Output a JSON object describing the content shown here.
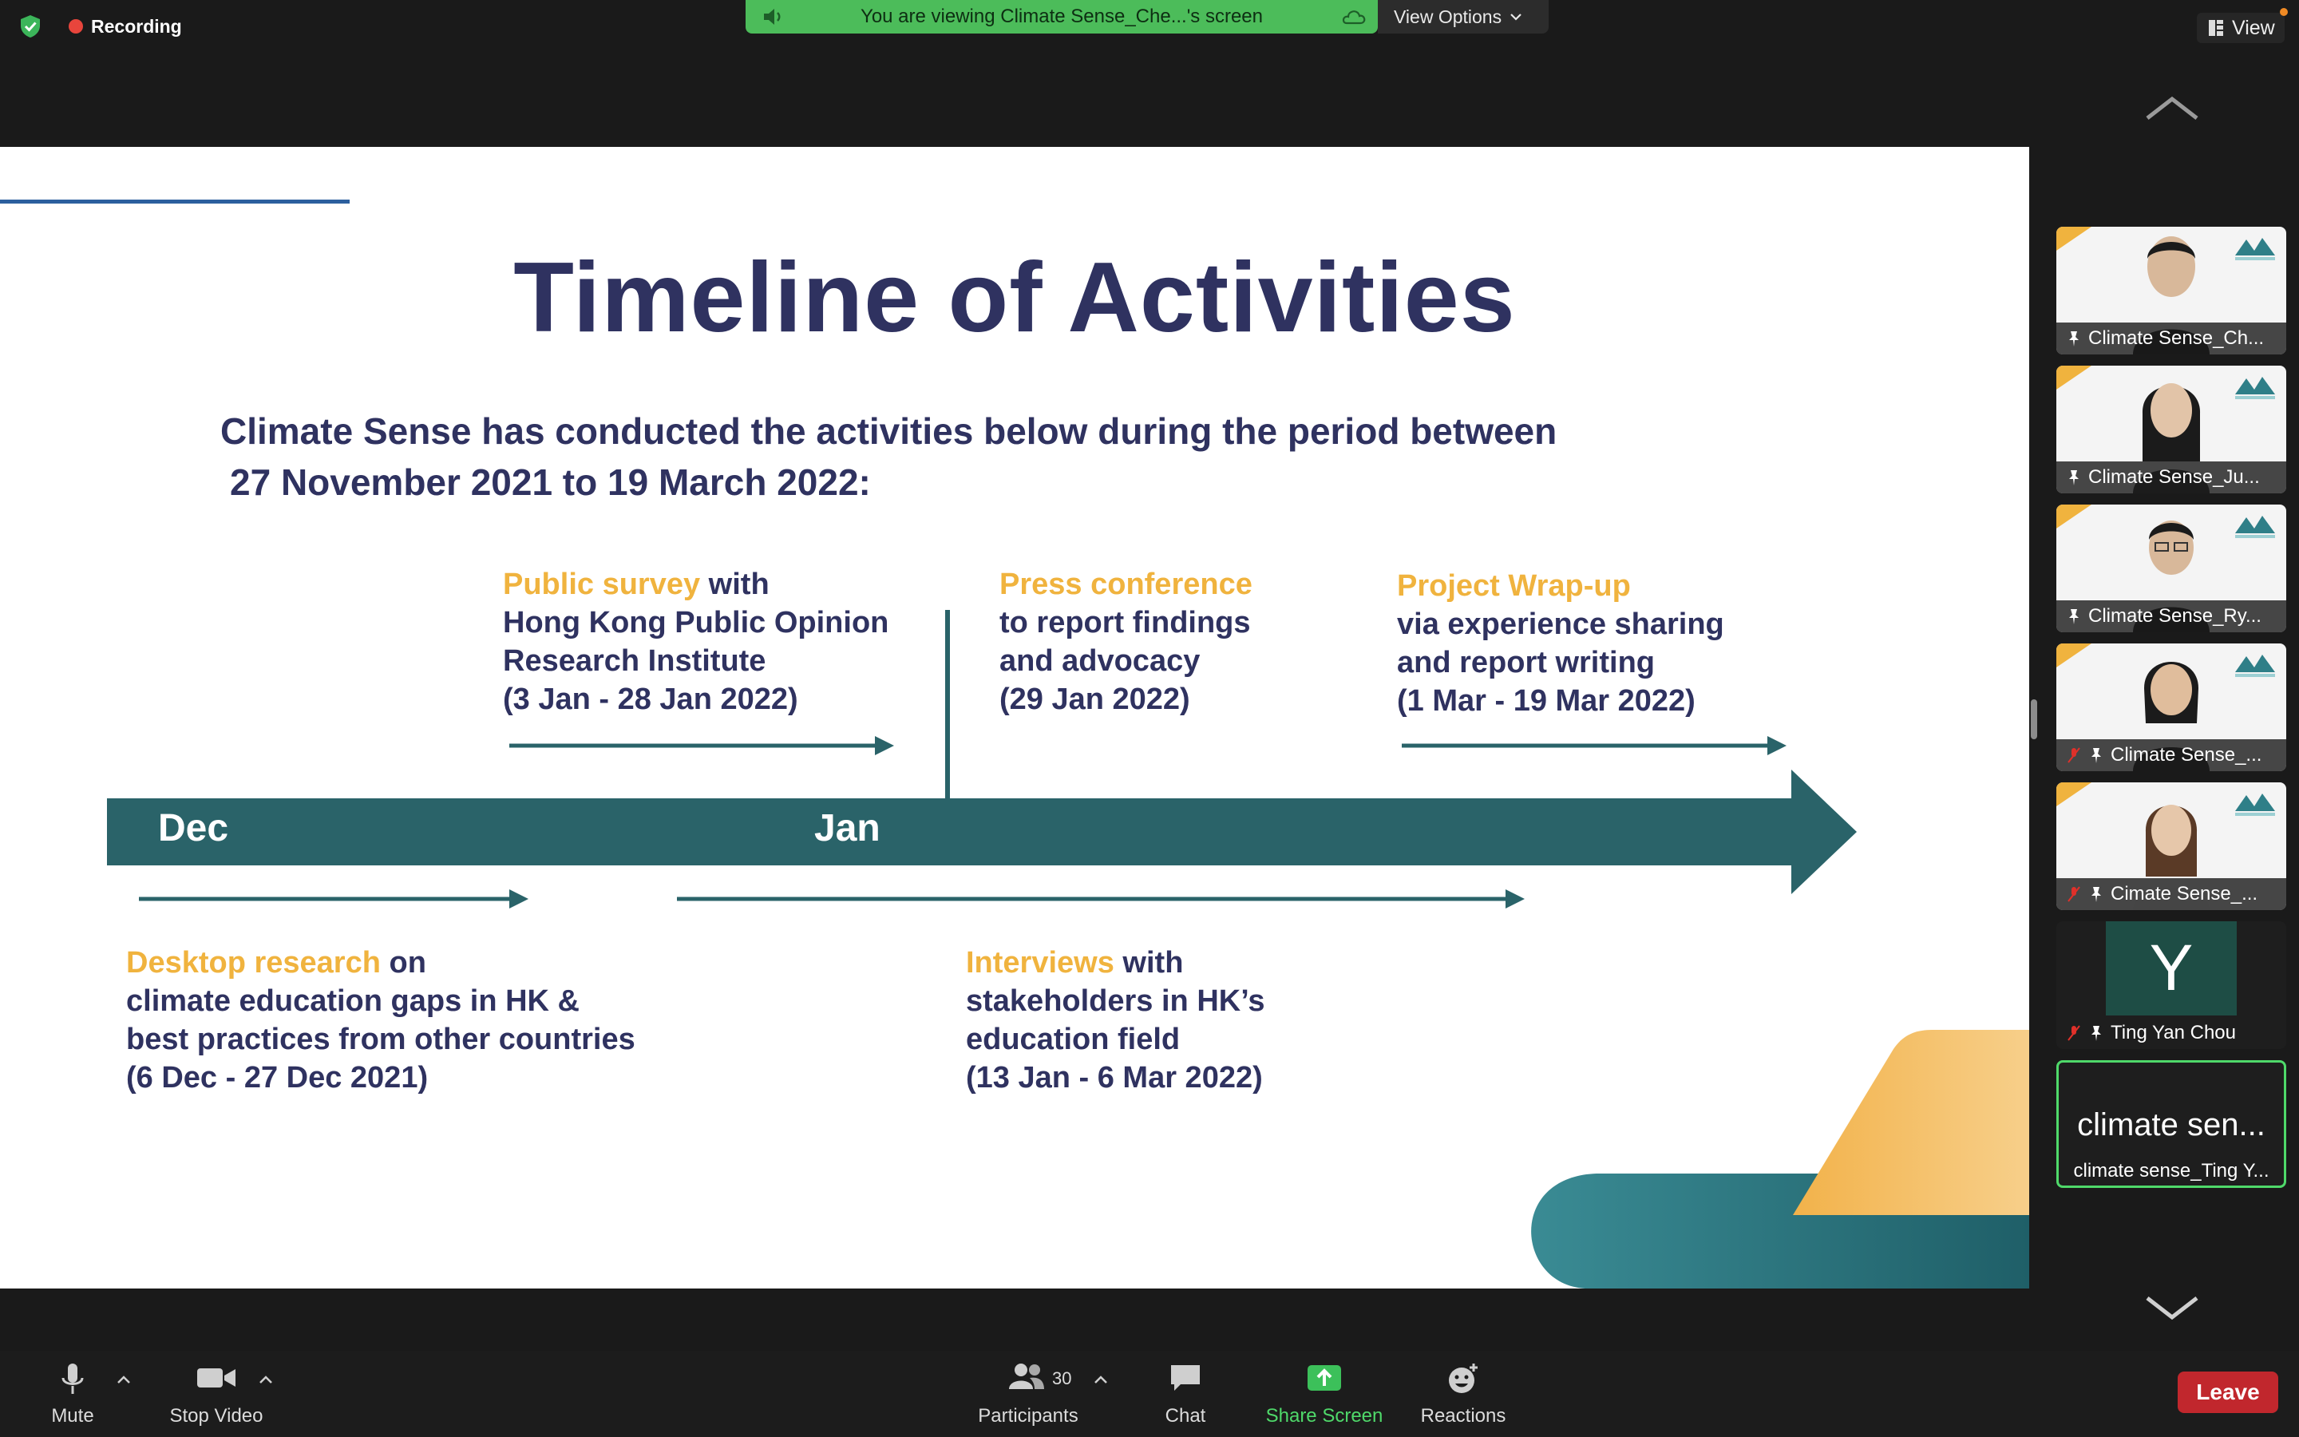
{
  "top_bar": {
    "recording_label": "Recording",
    "banner_text": "You are viewing Climate Sense_Che...'s screen",
    "view_options_label": "View Options",
    "view_label": "View"
  },
  "slide": {
    "title": "Timeline of Activities",
    "intro_line_1": "Climate Sense has conducted the activities below during the period between",
    "intro_line_2": "27 November 2021 to 19 March 2022:",
    "months": [
      "Dec",
      "Jan"
    ],
    "activities": {
      "public_survey": {
        "highlight": "Public survey",
        "lines": [
          " with",
          "Hong Kong Public Opinion",
          "Research Institute",
          "(3 Jan - 28 Jan 2022)"
        ]
      },
      "press_conference": {
        "highlight": "Press conference",
        "lines": [
          "to report findings",
          "and advocacy",
          "(29 Jan 2022)"
        ]
      },
      "project_wrapup": {
        "highlight": "Project Wrap-up",
        "lines": [
          "via experience sharing",
          "and report writing",
          "(1 Mar - 19 Mar 2022)"
        ]
      },
      "desktop_research": {
        "highlight": "Desktop research",
        "lines": [
          " on",
          "climate education gaps in HK &",
          "best practices from other countries",
          "(6 Dec - 27 Dec 2021)"
        ]
      },
      "interviews": {
        "highlight": "Interviews",
        "lines": [
          " with",
          "stakeholders in HK’s",
          "education field",
          "(13 Jan - 6 Mar 2022)"
        ]
      }
    },
    "colors": {
      "title": "#2f3260",
      "highlight": "#f0b33e",
      "timeline": "#2a6369",
      "orange": "#f0b33e",
      "teal": "#2f7f88"
    }
  },
  "gallery": {
    "tiles": [
      {
        "name": "Climate Sense_Ch..."
      },
      {
        "name": "Climate Sense_Ju..."
      },
      {
        "name": "Climate Sense_Ry..."
      },
      {
        "name": "Climate Sense_..."
      },
      {
        "name": "Cimate Sense_..."
      },
      {
        "name": "Ting Yan Chou",
        "avatar_letter": "Y"
      },
      {
        "name": "climate sense_Ting Y...",
        "big_label": "climate sen..."
      }
    ]
  },
  "toolbar": {
    "mute": "Mute",
    "stop_video": "Stop Video",
    "participants": "Participants",
    "participants_count": "30",
    "chat": "Chat",
    "share_screen": "Share Screen",
    "reactions": "Reactions",
    "leave": "Leave"
  },
  "icons": [
    "shield-check-icon",
    "speaker-icon",
    "cloud-icon",
    "chevron-down-icon",
    "view-grid-icon",
    "chevron-up-icon",
    "pin-icon",
    "mic-off-icon",
    "microphone-icon",
    "video-camera-icon",
    "participants-icon",
    "chat-bubble-icon",
    "share-arrow-icon",
    "reaction-smiley-icon"
  ]
}
